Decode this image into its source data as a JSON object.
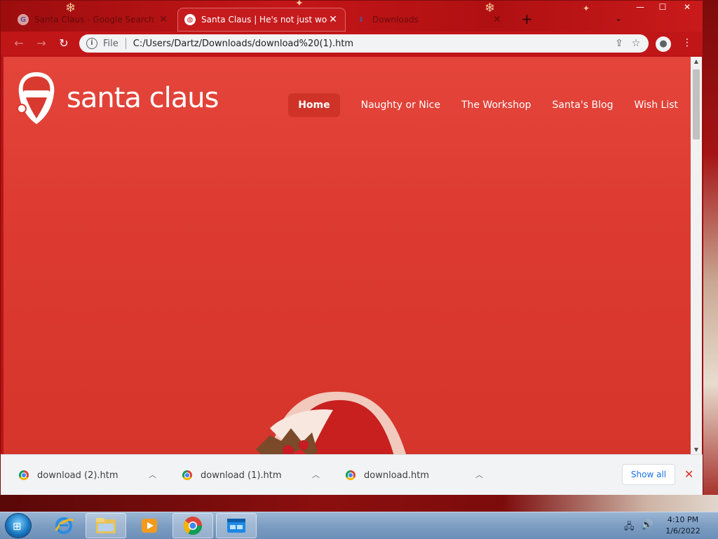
{
  "browser": {
    "tabs": [
      {
        "title": "Santa Claus - Google Search",
        "favicon": "google-icon"
      },
      {
        "title": "Santa Claus | He's not just wood",
        "favicon": "globe-icon",
        "active": true
      },
      {
        "title": "Downloads",
        "favicon": "download-icon"
      }
    ],
    "address": {
      "scheme": "File",
      "url": "C:/Users/Dartz/Downloads/download%20(1).htm"
    }
  },
  "site": {
    "logo_text": "santa claus",
    "nav": [
      "Home",
      "Naughty or Nice",
      "The Workshop",
      "Santa's Blog",
      "Wish List"
    ],
    "active_nav": "Home",
    "colors": {
      "background": "#dd3b31",
      "nav_active": "#cf3328"
    }
  },
  "downloads": {
    "items": [
      "download (2).htm",
      "download (1).htm",
      "download.htm"
    ],
    "show_all": "Show all"
  },
  "taskbar": {
    "time": "4:10 PM",
    "date": "1/6/2022",
    "apps": [
      "internet-explorer-icon",
      "file-explorer-icon",
      "media-player-icon",
      "chrome-icon",
      "window-app-icon"
    ]
  }
}
